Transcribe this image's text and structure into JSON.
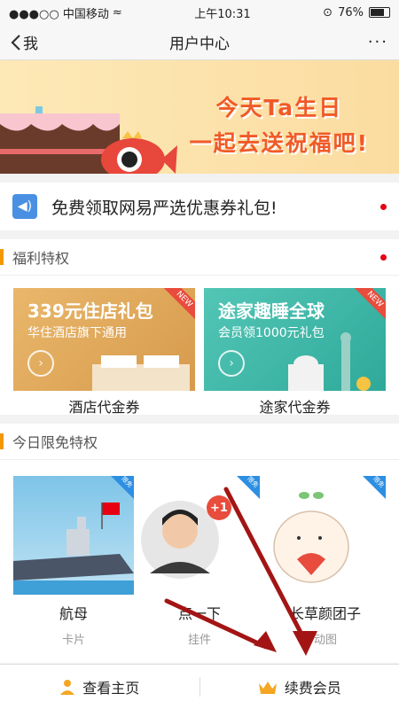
{
  "status": {
    "carrier": "●●●○○ 中国移动",
    "wifi": "≈",
    "time": "上午10:31",
    "battery": "76%"
  },
  "nav": {
    "back": "我",
    "title": "用户中心",
    "more": "···"
  },
  "banner": {
    "line1": "今天Ta生日",
    "line2": "一起去送祝福吧!"
  },
  "notice": {
    "text": "免费领取网易严选优惠券礼包!"
  },
  "welfare": {
    "title": "福利特权",
    "cards": [
      {
        "headline": "339元住店礼包",
        "sub": "华住酒店旗下通用",
        "badge": "NEW",
        "caption": "酒店代金券",
        "color": "#e3b36a"
      },
      {
        "headline": "途家趣睡全球",
        "sub": "会员领1000元礼包",
        "badge": "NEW",
        "caption": "途家代金券",
        "color": "#4fc1b4"
      }
    ]
  },
  "free": {
    "title": "今日限免特权",
    "items": [
      {
        "name": "航母",
        "sub": "卡片",
        "tag": "限免"
      },
      {
        "name": "点一下",
        "sub": "挂件",
        "tag": "限免",
        "badge": "+1"
      },
      {
        "name": "长草颜团子",
        "sub": "动图",
        "tag": "限免"
      }
    ]
  },
  "bottom": {
    "home": "查看主页",
    "renew": "续费会员"
  }
}
